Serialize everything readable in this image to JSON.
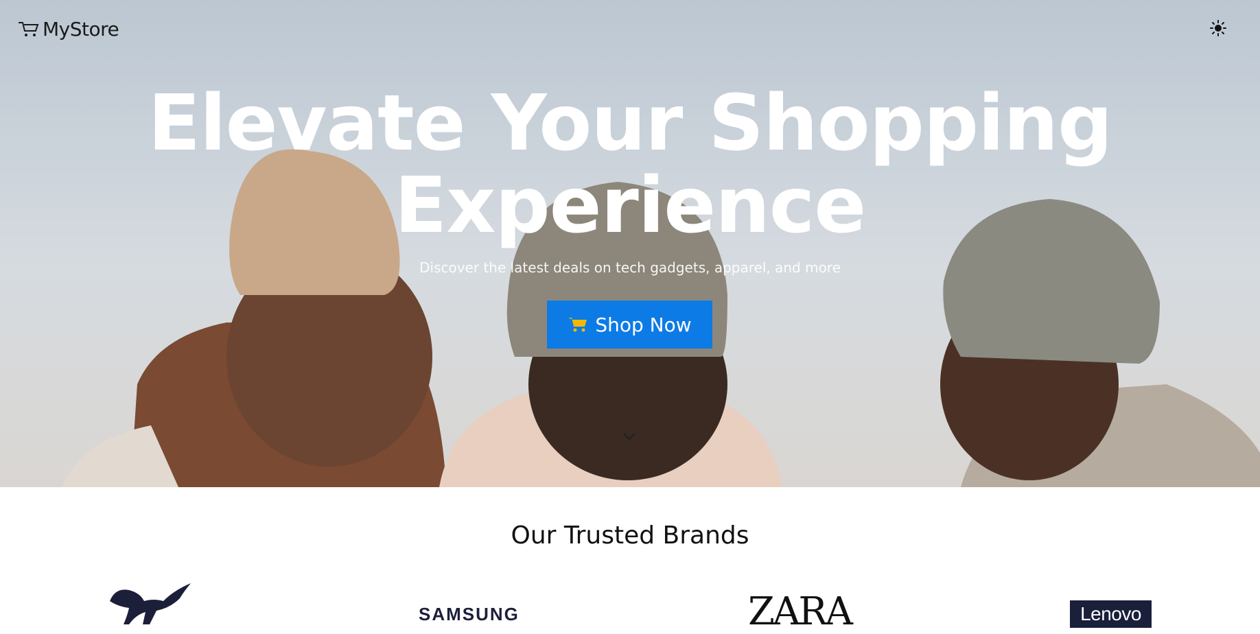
{
  "nav": {
    "logo_text": "MyStore",
    "theme_icon": "sun-icon"
  },
  "hero": {
    "title_line1": "Elevate Your Shopping",
    "title_line2": "Experience",
    "subtitle": "Discover the latest deals on tech gadgets, apparel, and more",
    "cta_label": "Shop Now",
    "cta_icon": "cart-icon",
    "scroll_icon": "chevron-down-icon"
  },
  "brands": {
    "heading": "Our Trusted Brands",
    "items": [
      {
        "name": "PUMA",
        "logo": "puma-logo"
      },
      {
        "name": "SAMSUNG",
        "logo": "samsung-logo"
      },
      {
        "name": "ZARA",
        "logo": "zara-logo"
      },
      {
        "name": "Lenovo",
        "logo": "lenovo-logo"
      }
    ]
  },
  "colors": {
    "cta_background": "#0d7be6",
    "cta_text": "#ffffff",
    "hero_text": "#ffffff",
    "heading_text": "#111111"
  }
}
